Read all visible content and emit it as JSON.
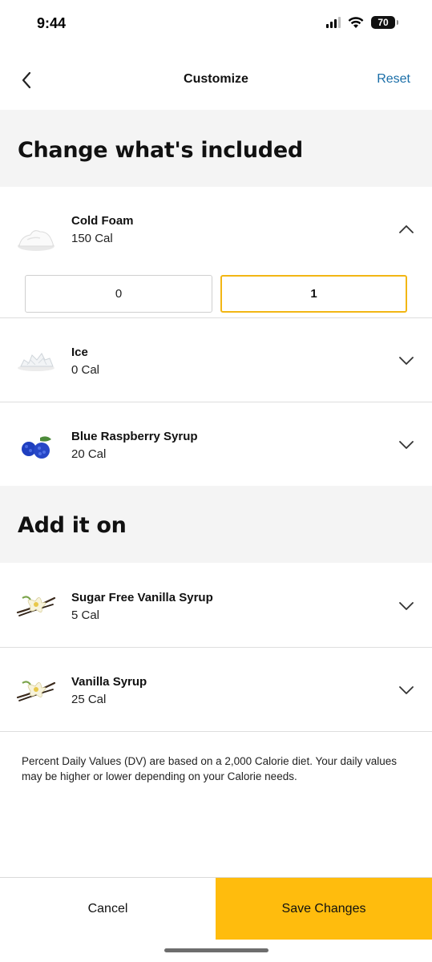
{
  "status_bar": {
    "time": "9:44",
    "battery": "70"
  },
  "header": {
    "title": "Customize",
    "reset_label": "Reset"
  },
  "sections": {
    "included_title": "Change what's included",
    "addon_title": "Add it on"
  },
  "included_items": [
    {
      "name": "Cold Foam",
      "calories": "150 Cal",
      "expanded": true
    },
    {
      "name": "Ice",
      "calories": "0 Cal",
      "expanded": false
    },
    {
      "name": "Blue Raspberry Syrup",
      "calories": "20 Cal",
      "expanded": false
    }
  ],
  "quantity_selector": {
    "options": [
      "0",
      "1"
    ],
    "selected": "1"
  },
  "addon_items": [
    {
      "name": "Sugar Free Vanilla Syrup",
      "calories": "5 Cal"
    },
    {
      "name": "Vanilla Syrup",
      "calories": "25 Cal"
    }
  ],
  "disclaimer": "Percent Daily Values (DV) are based on a 2,000 Calorie diet. Your daily values may be higher or lower depending on your Calorie needs.",
  "footer": {
    "cancel_label": "Cancel",
    "save_label": "Save Changes"
  },
  "colors": {
    "accent": "#ffbc0d",
    "selected_border": "#f2b614",
    "link": "#1a6ea8",
    "banner_bg": "#f4f4f4"
  },
  "icons": {
    "back": "chevron-left-icon",
    "expanded": "chevron-up-icon",
    "collapsed": "chevron-down-icon"
  }
}
